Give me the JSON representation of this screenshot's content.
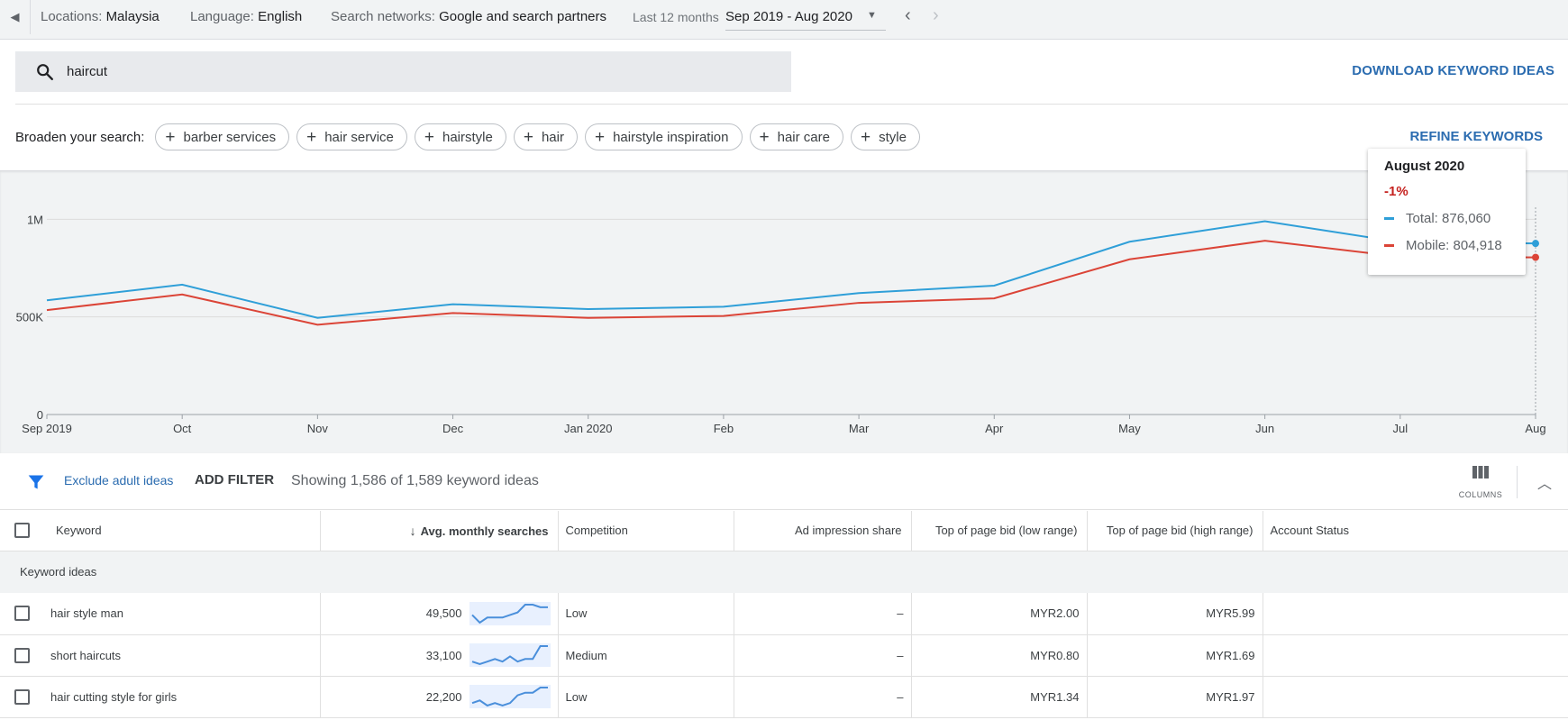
{
  "topbar": {
    "locations_label": "Locations:",
    "locations_value": "Malaysia",
    "language_label": "Language:",
    "language_value": "English",
    "networks_label": "Search networks:",
    "networks_value": "Google and search partners",
    "period_label": "Last 12 months",
    "date_range": "Sep 2019 - Aug 2020"
  },
  "search": {
    "query": "haircut"
  },
  "download_label": "DOWNLOAD KEYWORD IDEAS",
  "broaden": {
    "title": "Broaden your search:",
    "chips": [
      "barber services",
      "hair service",
      "hairstyle",
      "hair",
      "hairstyle inspiration",
      "hair care",
      "style"
    ]
  },
  "refine_label": "REFINE KEYWORDS",
  "tooltip": {
    "title": "August 2020",
    "change": "-1%",
    "total_label": "Total: 876,060",
    "mobile_label": "Mobile: 804,918",
    "total_color": "#2f9fd8",
    "mobile_color": "#db4437"
  },
  "chart_data": {
    "type": "line",
    "categories": [
      "Sep 2019",
      "Oct",
      "Nov",
      "Dec",
      "Jan 2020",
      "Feb",
      "Mar",
      "Apr",
      "May",
      "Jun",
      "Jul",
      "Aug"
    ],
    "yticks": [
      "0",
      "500K",
      "1M"
    ],
    "ylim": [
      0,
      1200000
    ],
    "series": [
      {
        "name": "Total",
        "color": "#2f9fd8",
        "values": [
          585000,
          665000,
          495000,
          565000,
          540000,
          552000,
          622000,
          660000,
          885000,
          990000,
          883000,
          876060
        ]
      },
      {
        "name": "Mobile",
        "color": "#db4437",
        "values": [
          535000,
          615000,
          460000,
          520000,
          495000,
          505000,
          572000,
          595000,
          795000,
          890000,
          808000,
          804918
        ]
      }
    ]
  },
  "filters": {
    "exclude_label": "Exclude adult ideas",
    "add_filter_label": "ADD FILTER",
    "showing_text": "Showing 1,586 of 1,589 keyword ideas",
    "columns_label": "COLUMNS"
  },
  "table": {
    "headers": {
      "keyword": "Keyword",
      "avg": "Avg. monthly searches",
      "competition": "Competition",
      "ad_share": "Ad impression share",
      "bid_low": "Top of page bid (low range)",
      "bid_high": "Top of page bid (high range)",
      "status": "Account Status"
    },
    "section_label": "Keyword ideas",
    "rows": [
      {
        "keyword": "hair style man",
        "avg": "49,500",
        "competition": "Low",
        "ad_share": "–",
        "bid_low": "MYR2.00",
        "bid_high": "MYR5.99",
        "trend": [
          5,
          2,
          4,
          4,
          4,
          5,
          6,
          9,
          9,
          8,
          8
        ]
      },
      {
        "keyword": "short haircuts",
        "avg": "33,100",
        "competition": "Medium",
        "ad_share": "–",
        "bid_low": "MYR0.80",
        "bid_high": "MYR1.69",
        "trend": [
          3,
          2,
          3,
          4,
          3,
          5,
          3,
          4,
          4,
          9,
          9
        ]
      },
      {
        "keyword": "hair cutting style for girls",
        "avg": "22,200",
        "competition": "Low",
        "ad_share": "–",
        "bid_low": "MYR1.34",
        "bid_high": "MYR1.97",
        "trend": [
          3,
          4,
          2,
          3,
          2,
          3,
          6,
          7,
          7,
          9,
          9
        ]
      }
    ]
  }
}
